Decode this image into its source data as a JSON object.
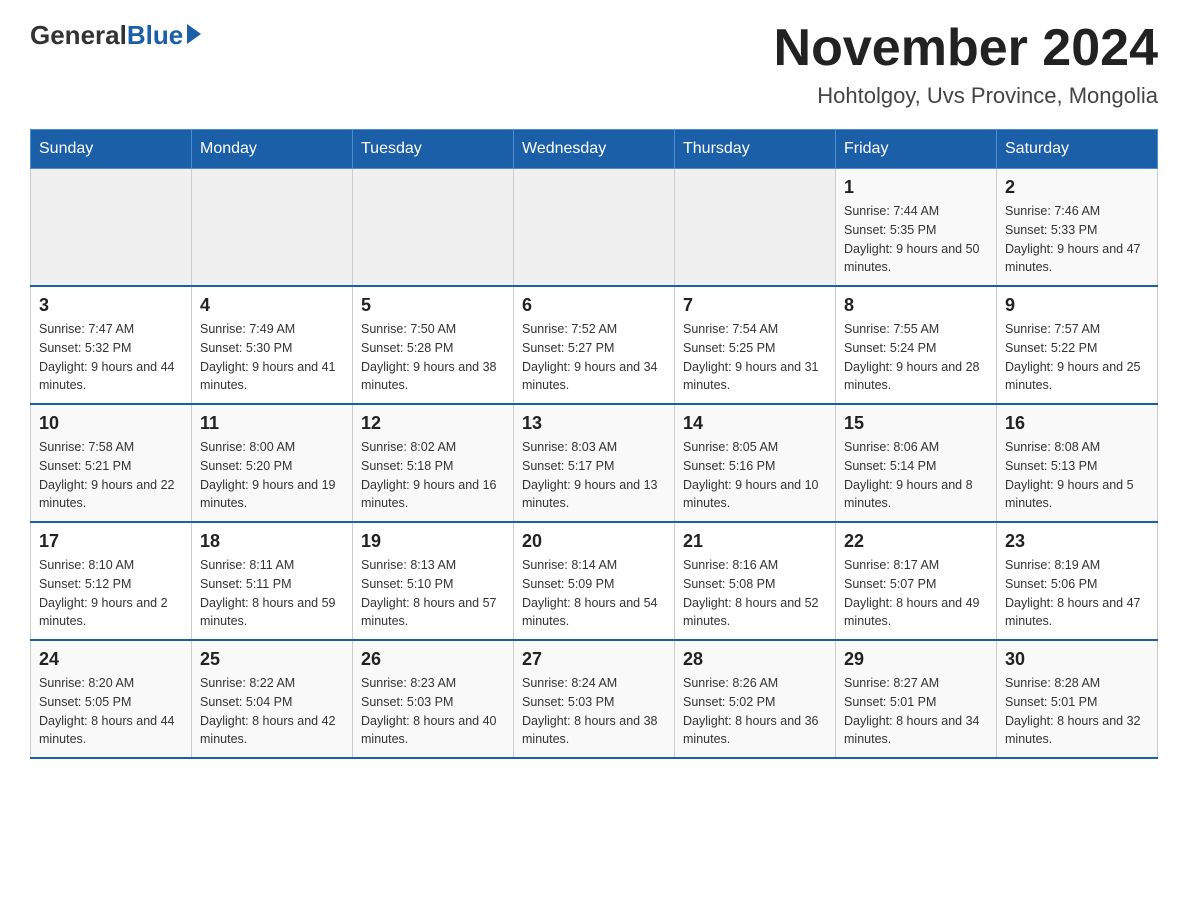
{
  "header": {
    "logo_general": "General",
    "logo_blue": "Blue",
    "month_title": "November 2024",
    "location": "Hohtolgoy, Uvs Province, Mongolia"
  },
  "weekdays": [
    "Sunday",
    "Monday",
    "Tuesday",
    "Wednesday",
    "Thursday",
    "Friday",
    "Saturday"
  ],
  "weeks": [
    [
      {
        "day": "",
        "info": ""
      },
      {
        "day": "",
        "info": ""
      },
      {
        "day": "",
        "info": ""
      },
      {
        "day": "",
        "info": ""
      },
      {
        "day": "",
        "info": ""
      },
      {
        "day": "1",
        "info": "Sunrise: 7:44 AM\nSunset: 5:35 PM\nDaylight: 9 hours and 50 minutes."
      },
      {
        "day": "2",
        "info": "Sunrise: 7:46 AM\nSunset: 5:33 PM\nDaylight: 9 hours and 47 minutes."
      }
    ],
    [
      {
        "day": "3",
        "info": "Sunrise: 7:47 AM\nSunset: 5:32 PM\nDaylight: 9 hours and 44 minutes."
      },
      {
        "day": "4",
        "info": "Sunrise: 7:49 AM\nSunset: 5:30 PM\nDaylight: 9 hours and 41 minutes."
      },
      {
        "day": "5",
        "info": "Sunrise: 7:50 AM\nSunset: 5:28 PM\nDaylight: 9 hours and 38 minutes."
      },
      {
        "day": "6",
        "info": "Sunrise: 7:52 AM\nSunset: 5:27 PM\nDaylight: 9 hours and 34 minutes."
      },
      {
        "day": "7",
        "info": "Sunrise: 7:54 AM\nSunset: 5:25 PM\nDaylight: 9 hours and 31 minutes."
      },
      {
        "day": "8",
        "info": "Sunrise: 7:55 AM\nSunset: 5:24 PM\nDaylight: 9 hours and 28 minutes."
      },
      {
        "day": "9",
        "info": "Sunrise: 7:57 AM\nSunset: 5:22 PM\nDaylight: 9 hours and 25 minutes."
      }
    ],
    [
      {
        "day": "10",
        "info": "Sunrise: 7:58 AM\nSunset: 5:21 PM\nDaylight: 9 hours and 22 minutes."
      },
      {
        "day": "11",
        "info": "Sunrise: 8:00 AM\nSunset: 5:20 PM\nDaylight: 9 hours and 19 minutes."
      },
      {
        "day": "12",
        "info": "Sunrise: 8:02 AM\nSunset: 5:18 PM\nDaylight: 9 hours and 16 minutes."
      },
      {
        "day": "13",
        "info": "Sunrise: 8:03 AM\nSunset: 5:17 PM\nDaylight: 9 hours and 13 minutes."
      },
      {
        "day": "14",
        "info": "Sunrise: 8:05 AM\nSunset: 5:16 PM\nDaylight: 9 hours and 10 minutes."
      },
      {
        "day": "15",
        "info": "Sunrise: 8:06 AM\nSunset: 5:14 PM\nDaylight: 9 hours and 8 minutes."
      },
      {
        "day": "16",
        "info": "Sunrise: 8:08 AM\nSunset: 5:13 PM\nDaylight: 9 hours and 5 minutes."
      }
    ],
    [
      {
        "day": "17",
        "info": "Sunrise: 8:10 AM\nSunset: 5:12 PM\nDaylight: 9 hours and 2 minutes."
      },
      {
        "day": "18",
        "info": "Sunrise: 8:11 AM\nSunset: 5:11 PM\nDaylight: 8 hours and 59 minutes."
      },
      {
        "day": "19",
        "info": "Sunrise: 8:13 AM\nSunset: 5:10 PM\nDaylight: 8 hours and 57 minutes."
      },
      {
        "day": "20",
        "info": "Sunrise: 8:14 AM\nSunset: 5:09 PM\nDaylight: 8 hours and 54 minutes."
      },
      {
        "day": "21",
        "info": "Sunrise: 8:16 AM\nSunset: 5:08 PM\nDaylight: 8 hours and 52 minutes."
      },
      {
        "day": "22",
        "info": "Sunrise: 8:17 AM\nSunset: 5:07 PM\nDaylight: 8 hours and 49 minutes."
      },
      {
        "day": "23",
        "info": "Sunrise: 8:19 AM\nSunset: 5:06 PM\nDaylight: 8 hours and 47 minutes."
      }
    ],
    [
      {
        "day": "24",
        "info": "Sunrise: 8:20 AM\nSunset: 5:05 PM\nDaylight: 8 hours and 44 minutes."
      },
      {
        "day": "25",
        "info": "Sunrise: 8:22 AM\nSunset: 5:04 PM\nDaylight: 8 hours and 42 minutes."
      },
      {
        "day": "26",
        "info": "Sunrise: 8:23 AM\nSunset: 5:03 PM\nDaylight: 8 hours and 40 minutes."
      },
      {
        "day": "27",
        "info": "Sunrise: 8:24 AM\nSunset: 5:03 PM\nDaylight: 8 hours and 38 minutes."
      },
      {
        "day": "28",
        "info": "Sunrise: 8:26 AM\nSunset: 5:02 PM\nDaylight: 8 hours and 36 minutes."
      },
      {
        "day": "29",
        "info": "Sunrise: 8:27 AM\nSunset: 5:01 PM\nDaylight: 8 hours and 34 minutes."
      },
      {
        "day": "30",
        "info": "Sunrise: 8:28 AM\nSunset: 5:01 PM\nDaylight: 8 hours and 32 minutes."
      }
    ]
  ]
}
